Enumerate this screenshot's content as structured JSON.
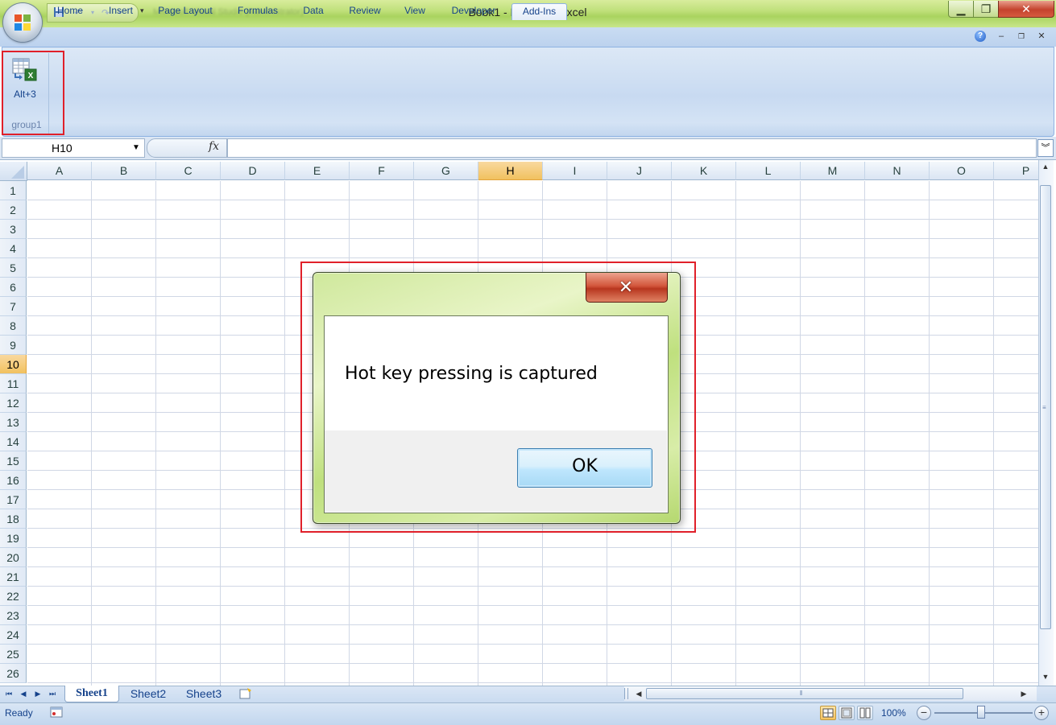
{
  "window": {
    "title": "Book1 - Microsoft Excel",
    "blurred_qat_text": "Microsoft Visual Studio (Administrator)",
    "accent_color": "#b5d86f"
  },
  "ribbon": {
    "tabs": [
      "Home",
      "Insert",
      "Page Layout",
      "Formulas",
      "Data",
      "Review",
      "View",
      "Developer",
      "Add-Ins"
    ],
    "active_tab": "Add-Ins",
    "group": {
      "label": "group1",
      "button_label": "Alt+3",
      "button_icon": "table-excel-icon"
    }
  },
  "formula_bar": {
    "name_box": "H10",
    "fx_label": "fx",
    "formula": ""
  },
  "grid": {
    "columns": [
      "A",
      "B",
      "C",
      "D",
      "E",
      "F",
      "G",
      "H",
      "I",
      "J",
      "K",
      "L",
      "M",
      "N",
      "O",
      "P"
    ],
    "rows": [
      "1",
      "2",
      "3",
      "4",
      "5",
      "6",
      "7",
      "8",
      "9",
      "10",
      "11",
      "12",
      "13",
      "14",
      "15",
      "16",
      "17",
      "18",
      "19",
      "20",
      "21",
      "22",
      "23",
      "24",
      "25",
      "26"
    ],
    "selected_column": "H",
    "selected_row": "10"
  },
  "sheets": {
    "tabs": [
      "Sheet1",
      "Sheet2",
      "Sheet3"
    ],
    "active": "Sheet1"
  },
  "status": {
    "text": "Ready",
    "zoom": "100%"
  },
  "dialog": {
    "message": "Hot key pressing is captured",
    "ok_label": "OK",
    "highlight_color": "#e0202a"
  }
}
